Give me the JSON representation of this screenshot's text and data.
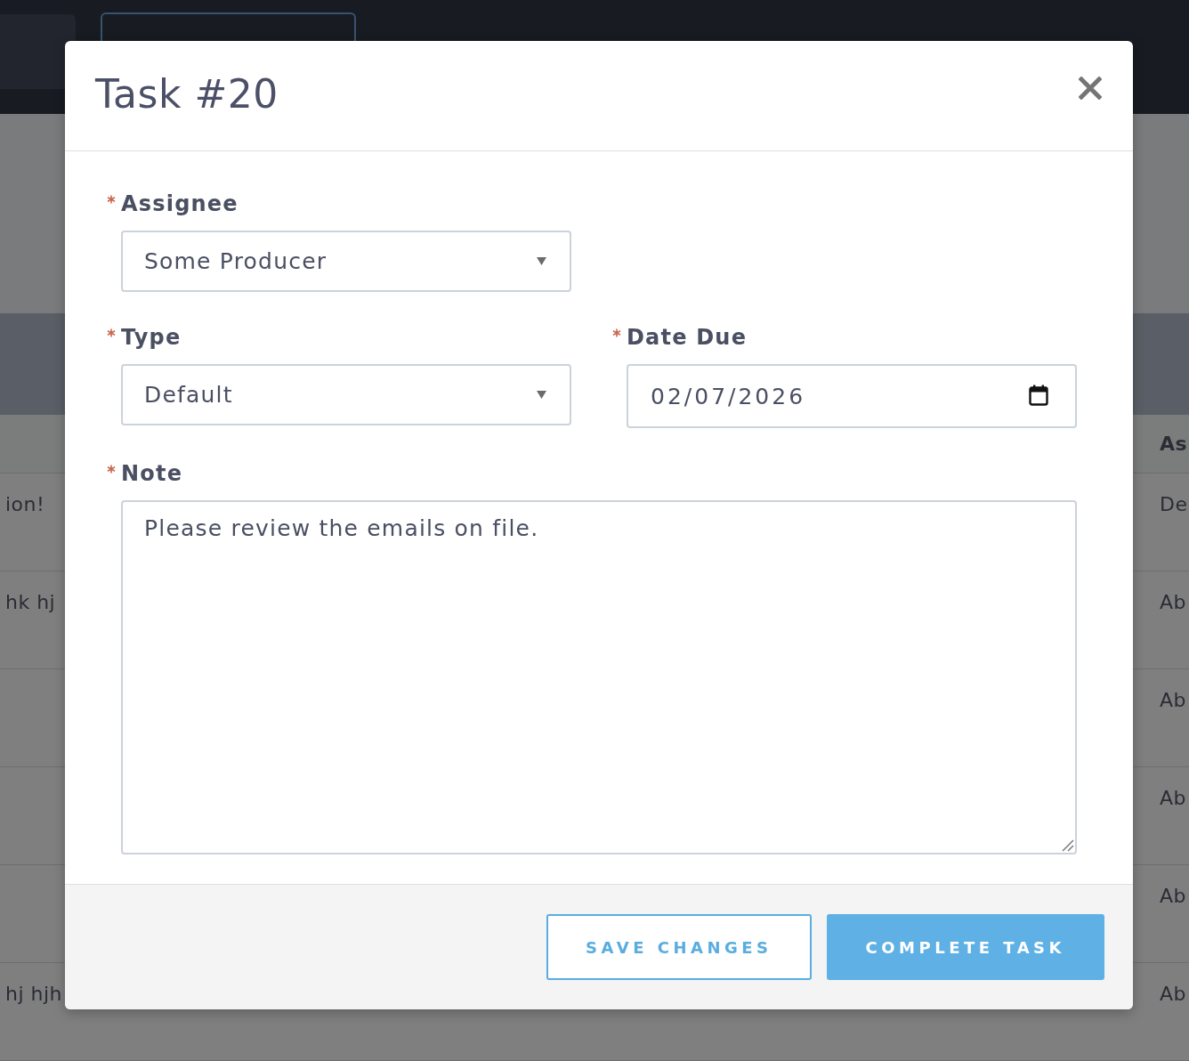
{
  "background_page": {
    "table": {
      "header": {
        "column_2": "As"
      },
      "rows": [
        {
          "column_1": "ion!",
          "column_2": "De"
        },
        {
          "column_1": "hk hj",
          "column_2": "Ab"
        },
        {
          "column_2": "Ab"
        },
        {
          "column_2": "Ab"
        },
        {
          "column_2": "Ab"
        },
        {
          "column_1": "hj hjh",
          "column_2": "Ab"
        }
      ]
    }
  },
  "dialog": {
    "title": "Task #20",
    "form_rows": [
      [
        {
          "kind": "select",
          "label": "Assignee",
          "required": true,
          "value": "Some Producer"
        }
      ],
      [
        {
          "kind": "select",
          "label": "Type",
          "required": true,
          "value": "Default"
        },
        {
          "kind": "date",
          "label": "Date Due",
          "required": true,
          "value": "02/07/2026"
        }
      ],
      [
        {
          "kind": "textarea",
          "label": "Note",
          "required": true,
          "value": "Please review the emails on file."
        }
      ]
    ],
    "buttons": [
      {
        "kind": "secondary",
        "label": "SAVE CHANGES"
      },
      {
        "kind": "primary",
        "label": "COMPLETE TASK"
      }
    ]
  }
}
